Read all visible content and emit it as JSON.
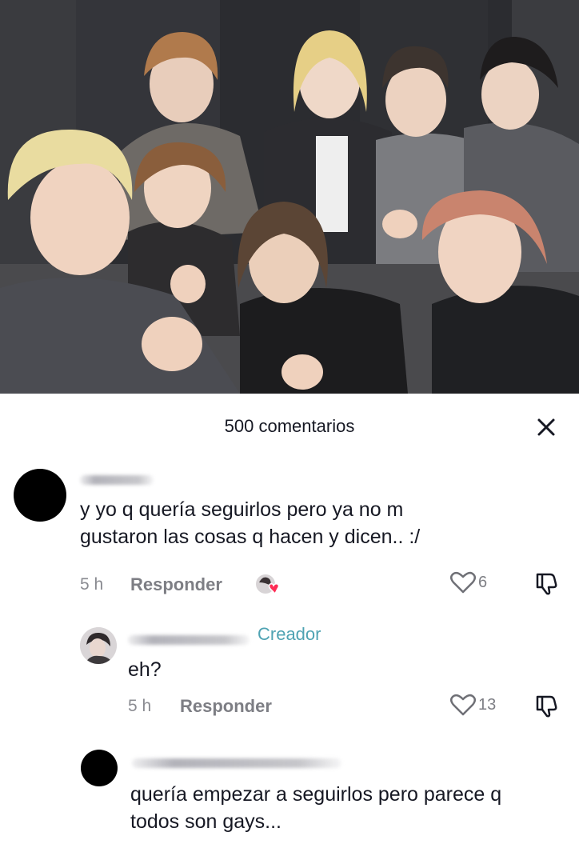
{
  "photo": {
    "subject": "group selfie of eight people",
    "icon": "group-photo"
  },
  "comments_panel": {
    "title": "500 comentarios",
    "close_icon": "close-icon",
    "comments": [
      {
        "text_line1": "y yo q quería seguirlos pero ya no m",
        "text_line2": "gustaron las cosas q hacen y dicen.. :/",
        "time": "5 h",
        "reply_label": "Responder",
        "likes": "6",
        "creator_reaction": "creator-liked-icon"
      },
      {
        "creator_label": "Creador",
        "text_line1": "eh?",
        "time": "5 h",
        "reply_label": "Responder",
        "likes": "13"
      },
      {
        "text_line1": "quería empezar a seguirlos pero parece q",
        "text_line2": "todos son gays..."
      }
    ]
  },
  "colors": {
    "text": "#161823",
    "muted": "#8a8b91",
    "creator_tag": "#4fa3b3",
    "like_heart": "#fe2c55"
  }
}
